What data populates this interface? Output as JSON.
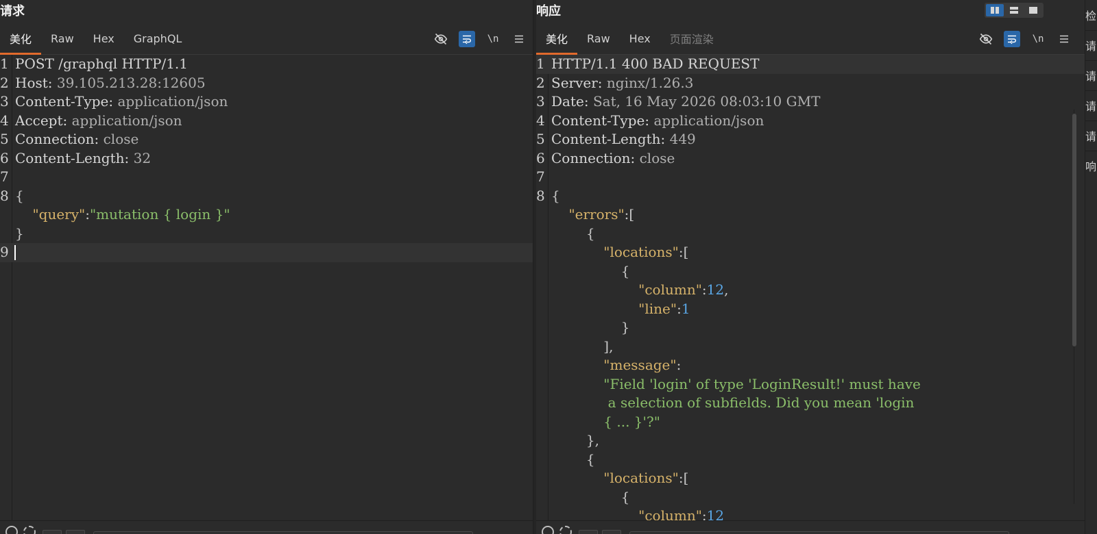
{
  "layout_toggle": {
    "options": [
      "side-by-side",
      "stacked",
      "single"
    ],
    "active": "side-by-side"
  },
  "right_strip": {
    "items": [
      "检",
      "请",
      "请",
      "请",
      "请",
      "响"
    ]
  },
  "request": {
    "title": "请求",
    "tabs": [
      {
        "label": "美化",
        "active": true
      },
      {
        "label": "Raw",
        "active": false
      },
      {
        "label": "Hex",
        "active": false
      },
      {
        "label": "GraphQL",
        "active": false
      }
    ],
    "tools": {
      "eye_icon": "eye-off-icon",
      "wrap_icon": "wrap-lines-icon",
      "newline_label": "\\n",
      "menu_icon": "hamburger-menu-icon"
    },
    "lines": [
      {
        "n": "1",
        "parts": [
          {
            "t": "POST /graphql HTTP/1.1",
            "c": "hdr-k"
          }
        ]
      },
      {
        "n": "2",
        "parts": [
          {
            "t": "Host: ",
            "c": "hdr-k"
          },
          {
            "t": "39.105.213.28:12605",
            "c": "hdr-v"
          }
        ]
      },
      {
        "n": "3",
        "parts": [
          {
            "t": "Content-Type: ",
            "c": "hdr-k"
          },
          {
            "t": "application/json",
            "c": "hdr-v"
          }
        ]
      },
      {
        "n": "4",
        "parts": [
          {
            "t": "Accept: ",
            "c": "hdr-k"
          },
          {
            "t": "application/json",
            "c": "hdr-v"
          }
        ]
      },
      {
        "n": "5",
        "parts": [
          {
            "t": "Connection: ",
            "c": "hdr-k"
          },
          {
            "t": "close",
            "c": "hdr-v"
          }
        ]
      },
      {
        "n": "6",
        "parts": [
          {
            "t": "Content-Length: ",
            "c": "hdr-k"
          },
          {
            "t": "32",
            "c": "hdr-v"
          }
        ]
      },
      {
        "n": "7",
        "parts": [
          {
            "t": "",
            "c": "hdr-k"
          }
        ]
      },
      {
        "n": "8",
        "parts": [
          {
            "t": "{",
            "c": "p"
          }
        ]
      },
      {
        "n": "",
        "parts": [
          {
            "t": "    ",
            "c": "p"
          },
          {
            "t": "\"query\"",
            "c": "k"
          },
          {
            "t": ":",
            "c": "p"
          },
          {
            "t": "\"mutation { login }\"",
            "c": "s"
          }
        ]
      },
      {
        "n": "",
        "parts": [
          {
            "t": "}",
            "c": "p"
          }
        ]
      },
      {
        "n": "9",
        "parts": [
          {
            "t": "",
            "c": "hdr-k"
          }
        ],
        "current": true,
        "cursor": true
      }
    ]
  },
  "response": {
    "title": "响应",
    "tabs": [
      {
        "label": "美化",
        "active": true
      },
      {
        "label": "Raw",
        "active": false
      },
      {
        "label": "Hex",
        "active": false
      },
      {
        "label": "页面渲染",
        "active": false,
        "disabled": true
      }
    ],
    "tools": {
      "eye_icon": "eye-off-icon",
      "wrap_icon": "wrap-lines-icon",
      "newline_label": "\\n",
      "menu_icon": "hamburger-menu-icon"
    },
    "lines": [
      {
        "n": "1",
        "parts": [
          {
            "t": "HTTP/1.1 400 BAD REQUEST",
            "c": "hdr-k"
          }
        ],
        "current": true
      },
      {
        "n": "2",
        "parts": [
          {
            "t": "Server: ",
            "c": "hdr-k"
          },
          {
            "t": "nginx/1.26.3",
            "c": "hdr-v"
          }
        ]
      },
      {
        "n": "3",
        "parts": [
          {
            "t": "Date: ",
            "c": "hdr-k"
          },
          {
            "t": "Sat, 16 May 2026 08:03:10 GMT",
            "c": "hdr-v"
          }
        ]
      },
      {
        "n": "4",
        "parts": [
          {
            "t": "Content-Type: ",
            "c": "hdr-k"
          },
          {
            "t": "application/json",
            "c": "hdr-v"
          }
        ]
      },
      {
        "n": "5",
        "parts": [
          {
            "t": "Content-Length: ",
            "c": "hdr-k"
          },
          {
            "t": "449",
            "c": "hdr-v"
          }
        ]
      },
      {
        "n": "6",
        "parts": [
          {
            "t": "Connection: ",
            "c": "hdr-k"
          },
          {
            "t": "close",
            "c": "hdr-v"
          }
        ]
      },
      {
        "n": "7",
        "parts": [
          {
            "t": "",
            "c": "hdr-k"
          }
        ]
      },
      {
        "n": "8",
        "parts": [
          {
            "t": "{",
            "c": "p"
          }
        ]
      },
      {
        "n": "",
        "parts": [
          {
            "t": "    ",
            "c": "p"
          },
          {
            "t": "\"errors\"",
            "c": "k"
          },
          {
            "t": ":[",
            "c": "p"
          }
        ]
      },
      {
        "n": "",
        "parts": [
          {
            "t": "        {",
            "c": "p"
          }
        ]
      },
      {
        "n": "",
        "parts": [
          {
            "t": "            ",
            "c": "p"
          },
          {
            "t": "\"locations\"",
            "c": "k"
          },
          {
            "t": ":[",
            "c": "p"
          }
        ]
      },
      {
        "n": "",
        "parts": [
          {
            "t": "                {",
            "c": "p"
          }
        ]
      },
      {
        "n": "",
        "parts": [
          {
            "t": "                    ",
            "c": "p"
          },
          {
            "t": "\"column\"",
            "c": "k"
          },
          {
            "t": ":",
            "c": "p"
          },
          {
            "t": "12",
            "c": "n"
          },
          {
            "t": ",",
            "c": "p"
          }
        ]
      },
      {
        "n": "",
        "parts": [
          {
            "t": "                    ",
            "c": "p"
          },
          {
            "t": "\"line\"",
            "c": "k"
          },
          {
            "t": ":",
            "c": "p"
          },
          {
            "t": "1",
            "c": "n"
          }
        ]
      },
      {
        "n": "",
        "parts": [
          {
            "t": "                }",
            "c": "p"
          }
        ]
      },
      {
        "n": "",
        "parts": [
          {
            "t": "            ],",
            "c": "p"
          }
        ]
      },
      {
        "n": "",
        "parts": [
          {
            "t": "            ",
            "c": "p"
          },
          {
            "t": "\"message\"",
            "c": "k"
          },
          {
            "t": ":",
            "c": "p"
          }
        ]
      },
      {
        "n": "",
        "parts": [
          {
            "t": "            ",
            "c": "p"
          },
          {
            "t": "\"Field 'login' of type 'LoginResult!' must have",
            "c": "s"
          }
        ]
      },
      {
        "n": "",
        "parts": [
          {
            "t": "             ",
            "c": "p"
          },
          {
            "t": "a selection of subfields. Did you mean 'login",
            "c": "s"
          }
        ]
      },
      {
        "n": "",
        "parts": [
          {
            "t": "            ",
            "c": "p"
          },
          {
            "t": "{ ... }'?\"",
            "c": "s"
          }
        ]
      },
      {
        "n": "",
        "parts": [
          {
            "t": "        },",
            "c": "p"
          }
        ]
      },
      {
        "n": "",
        "parts": [
          {
            "t": "        {",
            "c": "p"
          }
        ]
      },
      {
        "n": "",
        "parts": [
          {
            "t": "            ",
            "c": "p"
          },
          {
            "t": "\"locations\"",
            "c": "k"
          },
          {
            "t": ":[",
            "c": "p"
          }
        ]
      },
      {
        "n": "",
        "parts": [
          {
            "t": "                {",
            "c": "p"
          }
        ]
      },
      {
        "n": "",
        "parts": [
          {
            "t": "                    ",
            "c": "p"
          },
          {
            "t": "\"column\"",
            "c": "k"
          },
          {
            "t": ":",
            "c": "p"
          },
          {
            "t": "12",
            "c": "n"
          }
        ]
      }
    ]
  }
}
